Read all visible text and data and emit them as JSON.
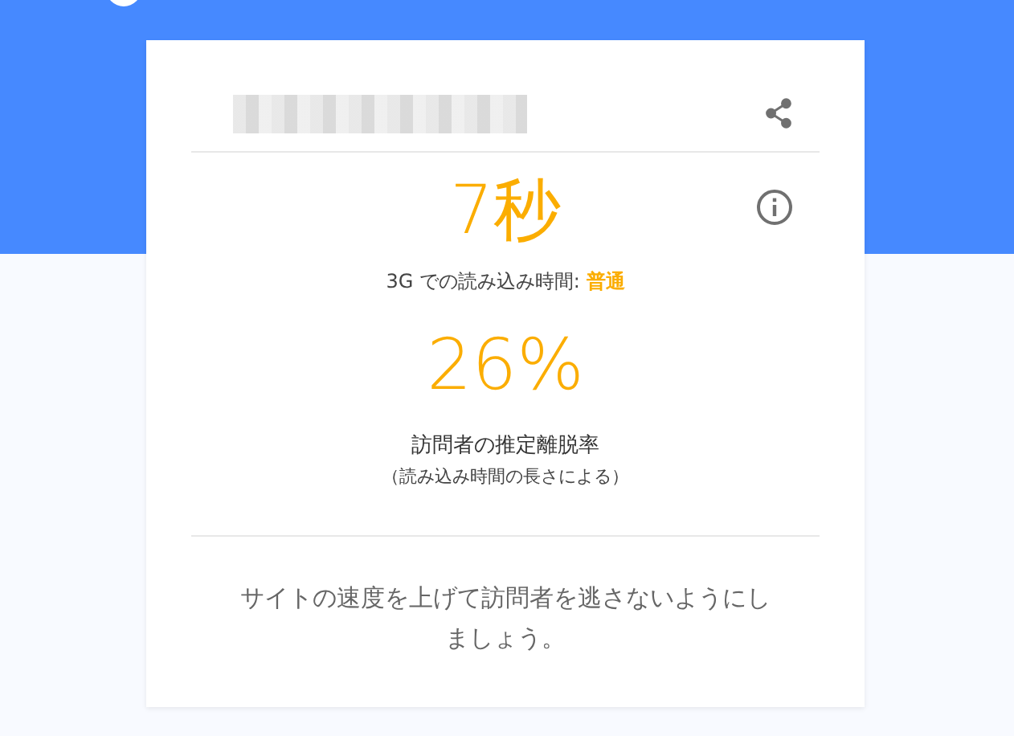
{
  "card": {
    "load_time": "7秒",
    "load_label": "3G での読み込み時間: ",
    "load_rating": "普通",
    "bounce_rate": "26%",
    "bounce_label": "訪問者の推定離脱率",
    "bounce_note": "（読み込み時間の長さによる）",
    "advice": "サイトの速度を上げて訪問者を逃さないようにしましょう。"
  }
}
